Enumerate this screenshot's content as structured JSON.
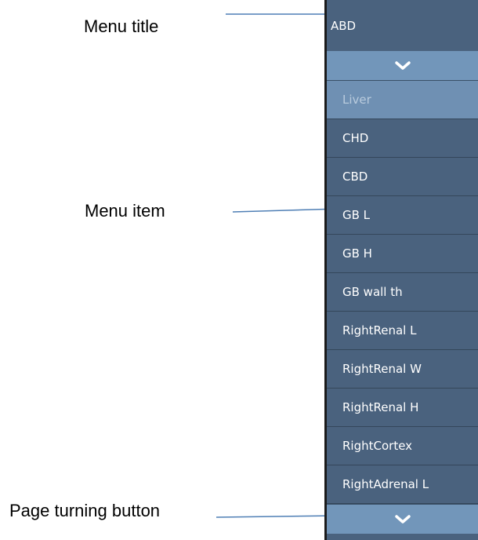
{
  "annotations": {
    "menu_title_label": "Menu title",
    "menu_item_label": "Menu item",
    "page_turning_label": "Page turning button"
  },
  "menu": {
    "title": "ABD",
    "items": [
      {
        "label": "Liver",
        "selected": true
      },
      {
        "label": "CHD",
        "selected": false
      },
      {
        "label": "CBD",
        "selected": false
      },
      {
        "label": "GB L",
        "selected": false
      },
      {
        "label": "GB H",
        "selected": false
      },
      {
        "label": "GB wall th",
        "selected": false
      },
      {
        "label": "RightRenal L",
        "selected": false
      },
      {
        "label": "RightRenal W",
        "selected": false
      },
      {
        "label": "RightRenal H",
        "selected": false
      },
      {
        "label": "RightCortex",
        "selected": false
      },
      {
        "label": "RightAdrenal L",
        "selected": false
      }
    ],
    "page_up_icon": "chevron-down-icon",
    "page_down_icon": "chevron-down-icon"
  },
  "colors": {
    "panel_background": "#4a627e",
    "page_button_background": "#7296ba",
    "selected_item_background": "#6f90b3",
    "selected_item_text": "#b9cbdd",
    "item_text": "#ffffff",
    "callout_line": "#4f7fb5"
  }
}
